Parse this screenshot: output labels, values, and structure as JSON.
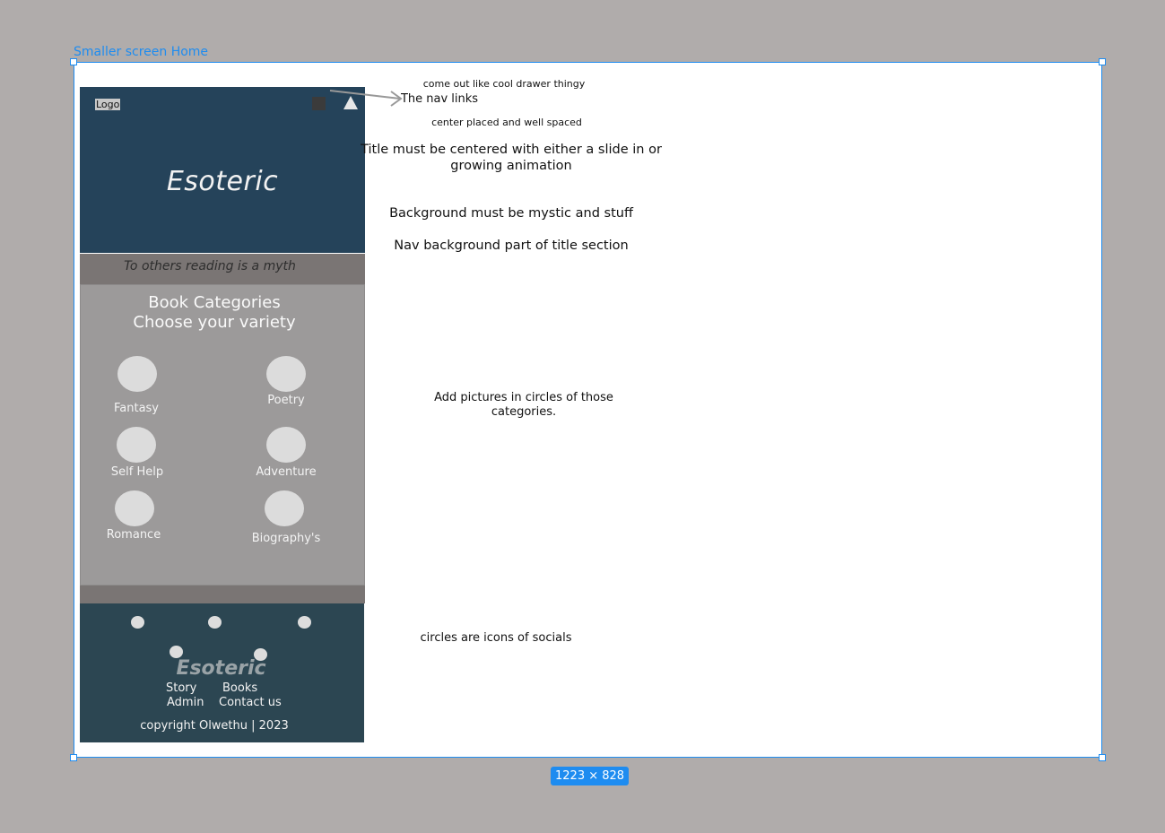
{
  "canvas": {
    "frame_label": "Smaller screen Home",
    "dimensions": "1223 × 828",
    "accent_color": "#1e8cf0",
    "background_color": "#b0acab"
  },
  "mockup": {
    "header": {
      "logo": "Logo",
      "title": "Esoteric",
      "nav_icons": [
        "square-icon",
        "triangle-icon"
      ],
      "background_color": "#25435a"
    },
    "tagline": "To others reading is a myth",
    "categories": {
      "heading_line1": "Book Categories",
      "heading_line2": "Choose your variety",
      "items": [
        {
          "label": "Fantasy"
        },
        {
          "label": "Poetry"
        },
        {
          "label": "Self Help"
        },
        {
          "label": "Adventure"
        },
        {
          "label": "Romance"
        },
        {
          "label": "Biography's"
        }
      ]
    },
    "footer": {
      "title": "Esoteric",
      "links": [
        "Story",
        "Books",
        "Admin",
        "Contact us"
      ],
      "copyright": "copyright Olwethu | 2023",
      "social_icons": [
        "social-icon",
        "social-icon",
        "social-icon",
        "social-icon",
        "social-icon"
      ],
      "background_color": "#2c4652"
    }
  },
  "annotations": {
    "drawer": "come out like cool drawer thingy",
    "nav_links": "The nav links",
    "center_placed": "center placed and well spaced",
    "title_line1": "Title must be centered with either a slide in or",
    "title_line2": "growing animation",
    "background": "Background must be mystic and stuff",
    "nav_background": "Nav background part of title section",
    "pictures_line1": "Add pictures in circles of those",
    "pictures_line2": "categories.",
    "socials": "circles are icons of socials"
  }
}
